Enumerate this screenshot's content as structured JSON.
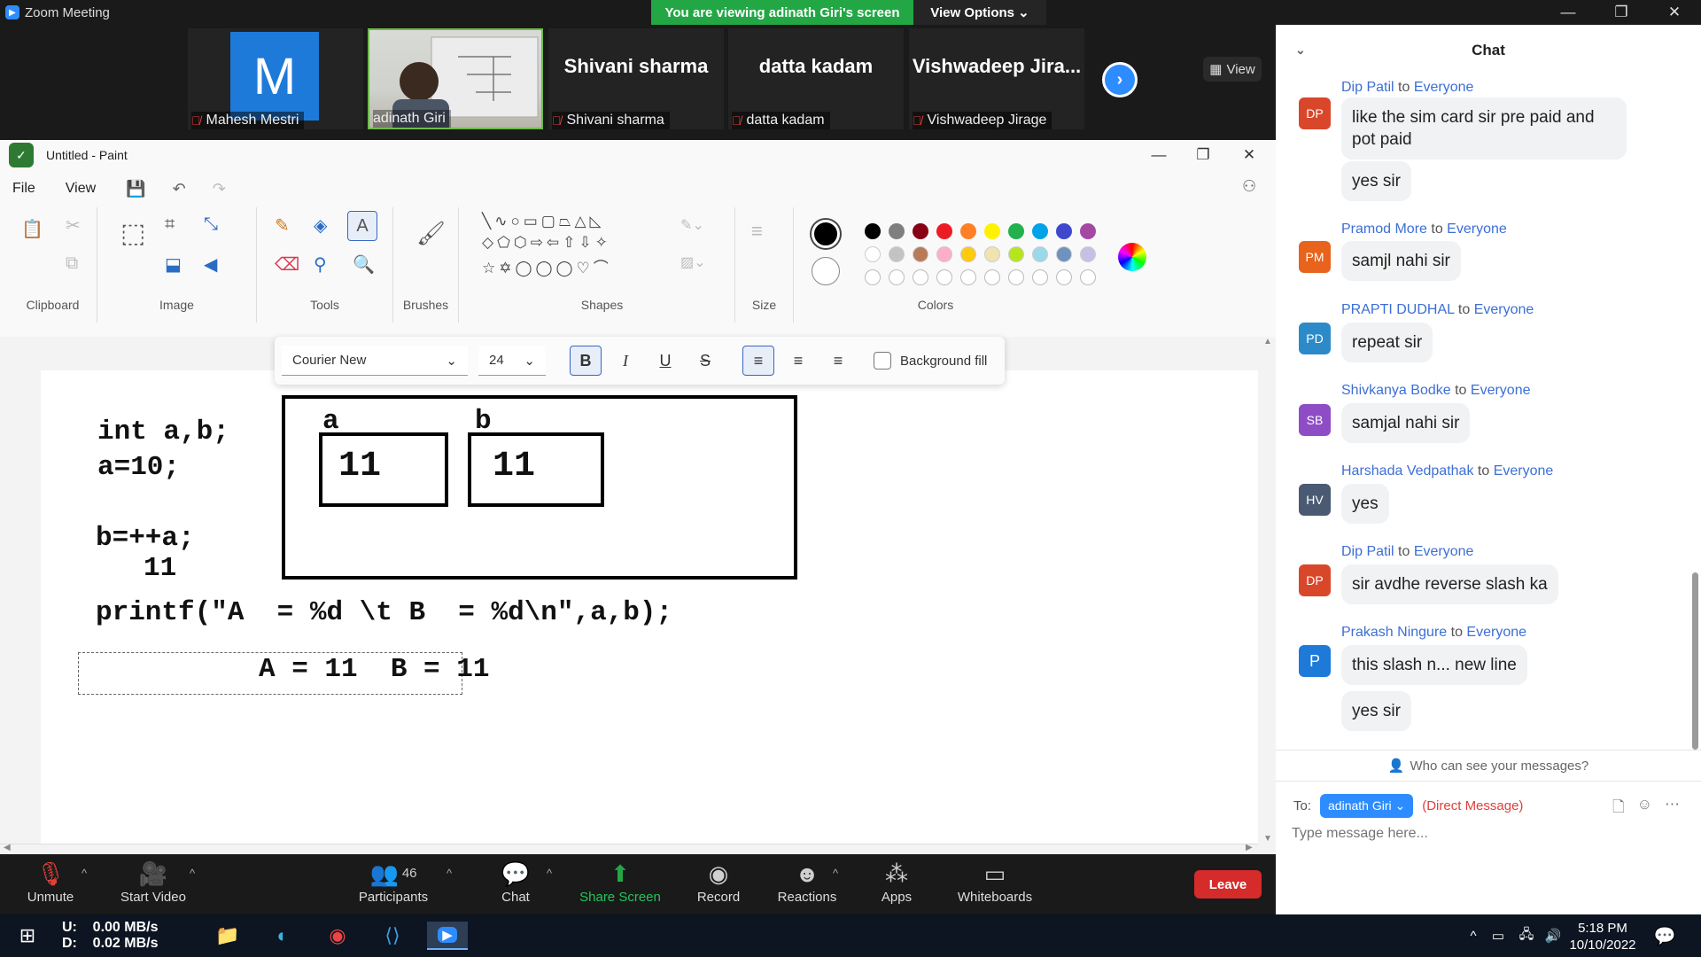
{
  "zoom": {
    "window_title": "Zoom Meeting",
    "viewing_banner": "You are viewing adinath Giri's screen",
    "view_options": "View Options ⌄",
    "view_button": "View",
    "accent": "#2d8cff",
    "banner_green": "#23a745"
  },
  "participants": [
    {
      "name": "Mahesh Mestri",
      "avatar": "M",
      "muted": true
    },
    {
      "name": "adinath Giri",
      "video": true,
      "muted": false
    },
    {
      "name": "Shivani sharma",
      "big": "Shivani sharma",
      "muted": true
    },
    {
      "name": "datta kadam",
      "big": "datta kadam",
      "muted": true
    },
    {
      "name": "Vishwadeep Jirage",
      "big": "Vishwadeep  Jira...",
      "muted": true
    }
  ],
  "paint": {
    "title": "Untitled - Paint",
    "menu": [
      "File",
      "View"
    ],
    "groups": {
      "clipboard": "Clipboard",
      "image": "Image",
      "tools": "Tools",
      "brushes": "Brushes",
      "shapes": "Shapes",
      "size": "Size",
      "colors": "Colors"
    },
    "text_toolbar": {
      "font": "Courier New",
      "size": "24",
      "bold": "B",
      "italic": "I",
      "underline": "U",
      "strike": "S",
      "background_fill": "Background fill"
    },
    "palette_row1": [
      "#000000",
      "#7f7f7f",
      "#880015",
      "#ed1c24",
      "#ff7f27",
      "#fff200",
      "#22b14c",
      "#00a2e8",
      "#3f48cc",
      "#a349a4"
    ],
    "palette_row2": [
      "#ffffff",
      "#c3c3c3",
      "#b97a57",
      "#ffaec9",
      "#ffc90e",
      "#efe4b0",
      "#b5e61d",
      "#99d9ea",
      "#7092be",
      "#c8bfe7"
    ],
    "canvas": {
      "line1": "int a,b;",
      "line2": "a=10;",
      "line3": "b=++a;",
      "line4": "11",
      "label_a": "a",
      "label_b": "b",
      "val_a": "11",
      "val_b": "11",
      "printf": "printf(\"A  = %d \\t B  = %d\\n\",a,b);",
      "output": "A = 11  B = 11"
    }
  },
  "chat": {
    "title": "Chat",
    "messages": [
      {
        "initials": "DP",
        "color": "#d9472b",
        "sender": "Dip Patil",
        "to": "to",
        "recipient": "Everyone",
        "bubbles": [
          "like the sim card sir pre paid and pot paid",
          "yes sir"
        ]
      },
      {
        "initials": "PM",
        "color": "#e8631c",
        "sender": "Pramod More",
        "to": "to",
        "recipient": "Everyone",
        "bubbles": [
          "samjl nahi sir"
        ]
      },
      {
        "initials": "PD",
        "color": "#2d8ac9",
        "sender": "PRAPTI DUDHAL",
        "to": "to",
        "recipient": "Everyone",
        "bubbles": [
          "repeat sir"
        ]
      },
      {
        "initials": "SB",
        "color": "#8e4dc4",
        "sender": "Shivkanya Bodke",
        "to": "to",
        "recipient": "Everyone",
        "bubbles": [
          "samjal nahi sir"
        ]
      },
      {
        "initials": "HV",
        "color": "#4a5a72",
        "sender": "Harshada Vedpathak",
        "to": "to",
        "recipient": "Everyone",
        "bubbles": [
          "yes"
        ]
      },
      {
        "initials": "DP",
        "color": "#d9472b",
        "sender": "Dip Patil",
        "to": "to",
        "recipient": "Everyone",
        "bubbles": [
          "sir avdhe reverse slash ka"
        ]
      },
      {
        "initials": "P",
        "color": "#1e7ad9",
        "sender": "Prakash Ningure",
        "to": "to",
        "recipient": "Everyone",
        "bubbles": [
          "this slash n... new line",
          "yes sir"
        ]
      }
    ],
    "who_can_see": "Who can see your messages?",
    "to_label": "To:",
    "recipient_select": "adinath Giri ⌄",
    "direct_message": "(Direct Message)",
    "input_placeholder": "Type message here..."
  },
  "toolbar": {
    "unmute": "Unmute",
    "start_video": "Start Video",
    "participants": "Participants",
    "participant_count": "46",
    "chat": "Chat",
    "share_screen": "Share Screen",
    "record": "Record",
    "reactions": "Reactions",
    "apps": "Apps",
    "whiteboards": "Whiteboards",
    "leave": "Leave"
  },
  "taskbar": {
    "upload": "U:    0.00 MB/s",
    "download": "D:    0.02 MB/s",
    "time": "5:18 PM",
    "date": "10/10/2022"
  }
}
